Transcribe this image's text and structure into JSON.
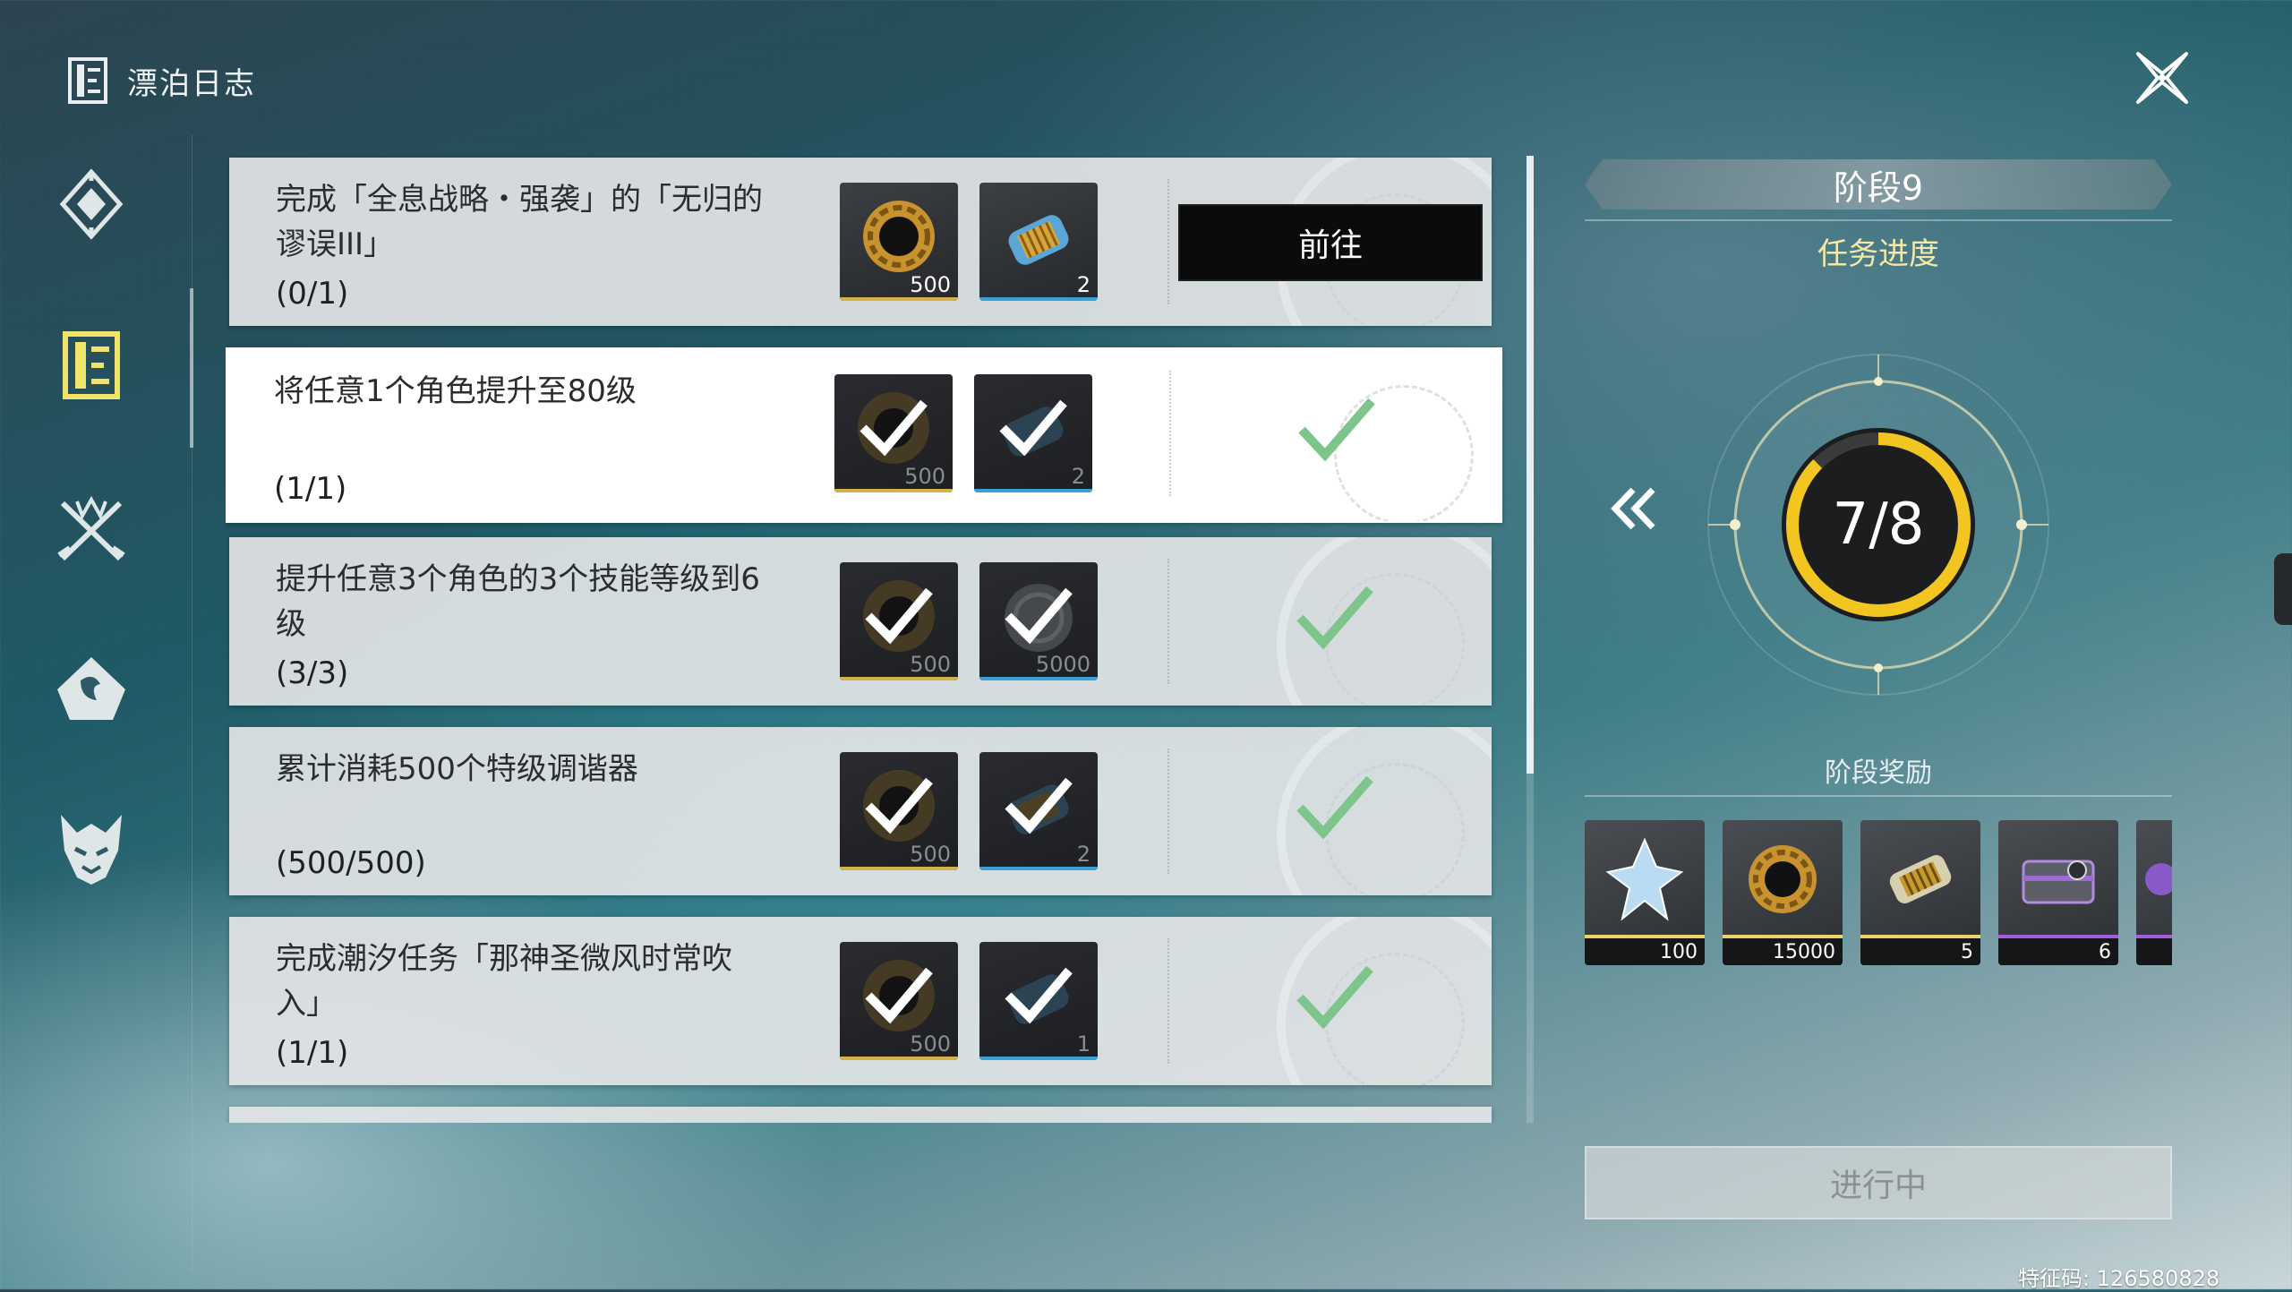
{
  "header": {
    "title": "漂泊日志",
    "icon": "journal-icon"
  },
  "sidebar": {
    "items": [
      {
        "name": "sidebar-item-diamond",
        "icon": "diamond-emblem-icon",
        "active": false
      },
      {
        "name": "sidebar-item-journal",
        "icon": "journal-icon",
        "active": true
      },
      {
        "name": "sidebar-item-combat",
        "icon": "crossed-swords-icon",
        "active": false
      },
      {
        "name": "sidebar-item-echo",
        "icon": "flame-emblem-icon",
        "active": false
      },
      {
        "name": "sidebar-item-monster",
        "icon": "monster-head-icon",
        "active": false
      }
    ]
  },
  "tasks": [
    {
      "text": "完成「全息战略・强袭」的「无归的谬误III」",
      "progress": "(0/1)",
      "completed": false,
      "action_label": "前往",
      "rewards": [
        {
          "icon": "shell-credit-icon",
          "count": "500",
          "rarity_color": "#d4b24a"
        },
        {
          "icon": "energy-core-icon",
          "count": "2",
          "rarity_color": "#3aa0d8"
        }
      ]
    },
    {
      "text": "将任意1个角色提升至80级",
      "progress": "(1/1)",
      "completed": true,
      "rewards": [
        {
          "icon": "shell-credit-icon",
          "count": "500",
          "rarity_color": "#d4b24a"
        },
        {
          "icon": "energy-core-icon",
          "count": "2",
          "rarity_color": "#3aa0d8"
        }
      ]
    },
    {
      "text": "提升任意3个角色的3个技能等级到6级",
      "progress": "(3/3)",
      "completed": true,
      "rewards": [
        {
          "icon": "shell-credit-icon",
          "count": "500",
          "rarity_color": "#d4b24a"
        },
        {
          "icon": "union-exp-icon",
          "count": "5000",
          "rarity_color": "#3aa0d8"
        }
      ]
    },
    {
      "text": "累计消耗500个特级调谐器",
      "progress": "(500/500)",
      "completed": true,
      "rewards": [
        {
          "icon": "shell-credit-icon",
          "count": "500",
          "rarity_color": "#d4b24a"
        },
        {
          "icon": "energy-core-icon",
          "count": "2",
          "rarity_color": "#3aa0d8"
        }
      ]
    },
    {
      "text": "完成潮汐任务「那神圣微风时常吹入」",
      "progress": "(1/1)",
      "completed": true,
      "rewards": [
        {
          "icon": "shell-credit-icon",
          "count": "500",
          "rarity_color": "#d4b24a"
        },
        {
          "icon": "energy-core-icon",
          "count": "1",
          "rarity_color": "#3aa0d8"
        }
      ]
    }
  ],
  "stage": {
    "title": "阶段9",
    "progress_label": "任务进度",
    "progress_text": "7/8",
    "progress_fraction": 0.875,
    "rewards_label": "阶段奖励",
    "rewards": [
      {
        "icon": "astrite-crystal-icon",
        "count": "100",
        "rarity_color": "#e8d46a"
      },
      {
        "icon": "shell-credit-icon",
        "count": "15000",
        "rarity_color": "#e8d46a"
      },
      {
        "icon": "energy-core-icon",
        "count": "5",
        "rarity_color": "#e8d46a"
      },
      {
        "icon": "supply-chest-icon",
        "count": "6",
        "rarity_color": "#a35ce0"
      },
      {
        "icon": "purple-item-icon",
        "count": "",
        "rarity_color": "#a35ce0"
      }
    ],
    "status_label": "进行中"
  },
  "footer": {
    "code": "特征码: 126580828"
  },
  "colors": {
    "accent_gold": "#f2c521",
    "check_green": "#7ec58c",
    "panel_light": "#e2e4e5"
  }
}
